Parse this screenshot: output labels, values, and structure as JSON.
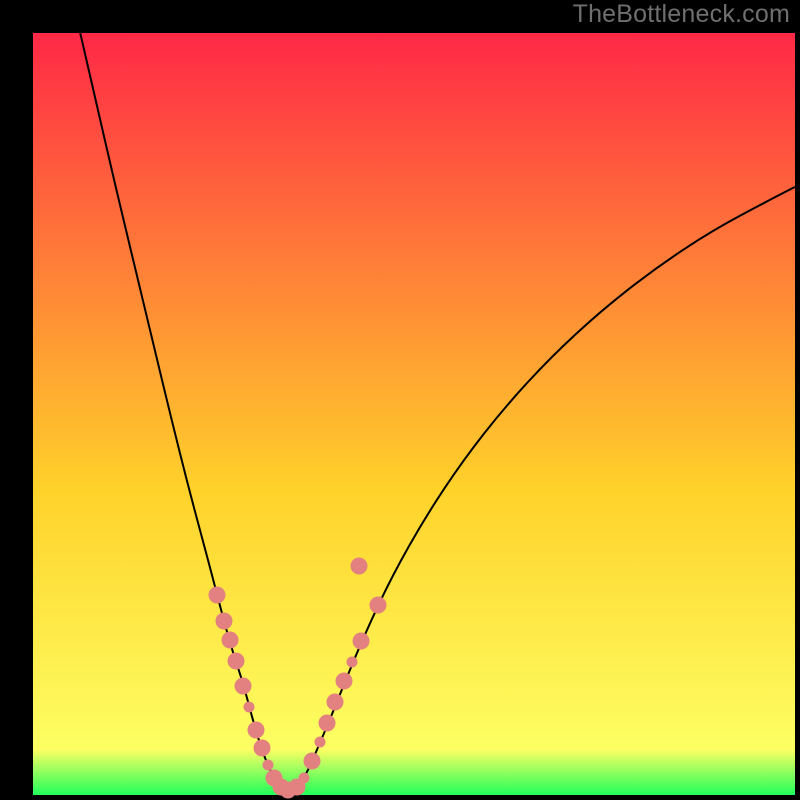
{
  "watermark": "TheBottleneck.com",
  "gradient": {
    "top": "#ff2846",
    "mid": "#ffd22a",
    "bottomish": "#fdff63",
    "green": "#21ff5a"
  },
  "chart_data": {
    "type": "line",
    "title": "",
    "xlabel": "",
    "ylabel": "",
    "xlim": [
      0,
      1
    ],
    "ylim": [
      0,
      1
    ],
    "series": [
      {
        "name": "curve",
        "stroke": "#000000",
        "stroke_width": 2,
        "points": [
          {
            "x": 0.062,
            "y": 1.0
          },
          {
            "x": 0.085,
            "y": 0.9
          },
          {
            "x": 0.108,
            "y": 0.8
          },
          {
            "x": 0.132,
            "y": 0.7
          },
          {
            "x": 0.156,
            "y": 0.6
          },
          {
            "x": 0.18,
            "y": 0.5
          },
          {
            "x": 0.205,
            "y": 0.4
          },
          {
            "x": 0.232,
            "y": 0.3
          },
          {
            "x": 0.258,
            "y": 0.2
          },
          {
            "x": 0.275,
            "y": 0.15
          },
          {
            "x": 0.288,
            "y": 0.1
          },
          {
            "x": 0.3,
            "y": 0.06
          },
          {
            "x": 0.312,
            "y": 0.03
          },
          {
            "x": 0.323,
            "y": 0.012
          },
          {
            "x": 0.335,
            "y": 0.005
          },
          {
            "x": 0.348,
            "y": 0.012
          },
          {
            "x": 0.36,
            "y": 0.03
          },
          {
            "x": 0.373,
            "y": 0.06
          },
          {
            "x": 0.39,
            "y": 0.1
          },
          {
            "x": 0.41,
            "y": 0.15
          },
          {
            "x": 0.435,
            "y": 0.21
          },
          {
            "x": 0.47,
            "y": 0.285
          },
          {
            "x": 0.515,
            "y": 0.365
          },
          {
            "x": 0.565,
            "y": 0.44
          },
          {
            "x": 0.62,
            "y": 0.51
          },
          {
            "x": 0.68,
            "y": 0.575
          },
          {
            "x": 0.745,
            "y": 0.635
          },
          {
            "x": 0.815,
            "y": 0.69
          },
          {
            "x": 0.89,
            "y": 0.74
          },
          {
            "x": 0.965,
            "y": 0.78
          },
          {
            "x": 1.0,
            "y": 0.798
          }
        ]
      }
    ],
    "dots": {
      "color": "#e38080",
      "items": [
        {
          "x": 0.242,
          "y": 0.262,
          "size": "big"
        },
        {
          "x": 0.251,
          "y": 0.228,
          "size": "big"
        },
        {
          "x": 0.258,
          "y": 0.204,
          "size": "big"
        },
        {
          "x": 0.266,
          "y": 0.176,
          "size": "big"
        },
        {
          "x": 0.276,
          "y": 0.143,
          "size": "big"
        },
        {
          "x": 0.284,
          "y": 0.115,
          "size": "small"
        },
        {
          "x": 0.293,
          "y": 0.085,
          "size": "big"
        },
        {
          "x": 0.3,
          "y": 0.062,
          "size": "big"
        },
        {
          "x": 0.308,
          "y": 0.04,
          "size": "small"
        },
        {
          "x": 0.316,
          "y": 0.022,
          "size": "big"
        },
        {
          "x": 0.326,
          "y": 0.01,
          "size": "big"
        },
        {
          "x": 0.334,
          "y": 0.006,
          "size": "big"
        },
        {
          "x": 0.346,
          "y": 0.01,
          "size": "big"
        },
        {
          "x": 0.356,
          "y": 0.022,
          "size": "small"
        },
        {
          "x": 0.366,
          "y": 0.044,
          "size": "big"
        },
        {
          "x": 0.376,
          "y": 0.07,
          "size": "small"
        },
        {
          "x": 0.386,
          "y": 0.095,
          "size": "big"
        },
        {
          "x": 0.396,
          "y": 0.122,
          "size": "big"
        },
        {
          "x": 0.408,
          "y": 0.15,
          "size": "big"
        },
        {
          "x": 0.418,
          "y": 0.175,
          "size": "small"
        },
        {
          "x": 0.43,
          "y": 0.202,
          "size": "big"
        },
        {
          "x": 0.453,
          "y": 0.25,
          "size": "big"
        },
        {
          "x": 0.428,
          "y": 0.3,
          "size": "big"
        }
      ]
    }
  }
}
